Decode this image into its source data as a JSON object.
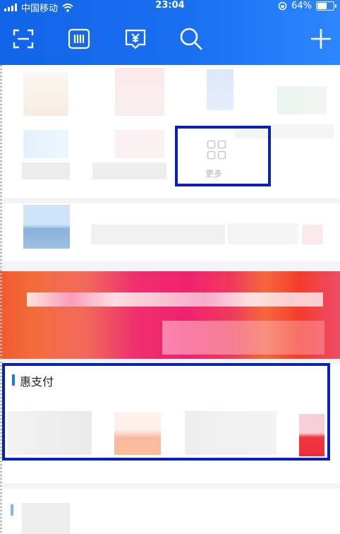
{
  "status_bar": {
    "carrier": "中国移动",
    "time": "23:04",
    "battery": "64%",
    "battery_level": 0.64
  },
  "toolbar": {
    "icons": [
      "scan-icon",
      "payment-code-icon",
      "receive-money-icon",
      "search-icon",
      "add-icon"
    ]
  },
  "grid": {
    "more_label": "更多"
  },
  "section": {
    "title": "惠支付"
  },
  "colors": {
    "header_blue": "#1a6ff0",
    "highlight_border": "#0a21b5",
    "accent_bar": "#1677ff"
  }
}
